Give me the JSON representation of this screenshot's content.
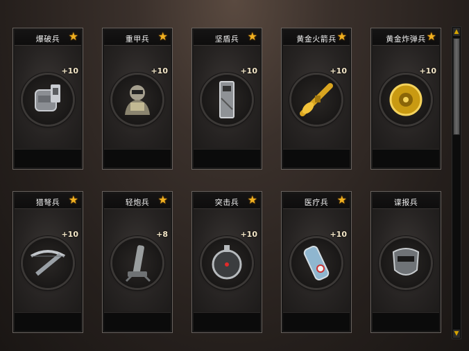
{
  "colors": {
    "star": "#f0b020",
    "accent": "#d6a400"
  },
  "cards": [
    {
      "name": "爆破兵",
      "star": true,
      "plus": "+10",
      "icon": "demolition-vest-icon",
      "gems": [
        "red",
        "red",
        "red",
        "blue",
        "blue",
        "blue",
        "yellow",
        "yellow",
        "yellow",
        "purple"
      ]
    },
    {
      "name": "重甲兵",
      "star": true,
      "plus": "+10",
      "icon": "heavy-armor-soldier-icon",
      "gems": [
        "red",
        "red",
        "red",
        "blue",
        "blue",
        "blue",
        "yellow",
        "yellow",
        "yellow",
        "purple"
      ]
    },
    {
      "name": "坚盾兵",
      "star": true,
      "plus": "+10",
      "icon": "riot-shield-icon",
      "gems": [
        "red",
        "red",
        "red",
        "blue",
        "blue",
        "blue",
        "yellow",
        "yellow",
        "yellow",
        "purple"
      ]
    },
    {
      "name": "黄金火箭兵",
      "star": true,
      "plus": "+10",
      "icon": "gold-rocket-launcher-icon",
      "gems": [
        "red",
        "red",
        "red",
        "blue",
        "blue",
        "blue",
        "yellow",
        "yellow",
        "yellow",
        "purple"
      ]
    },
    {
      "name": "黄金炸弹兵",
      "star": true,
      "plus": "+10",
      "icon": "gold-bomb-icon",
      "gems": [
        "red",
        "red",
        "red",
        "blue",
        "blue",
        "blue",
        "yellow",
        "yellow",
        "yellow",
        "purple"
      ]
    },
    {
      "name": "猎弩兵",
      "star": true,
      "plus": "+10",
      "icon": "crossbow-icon",
      "gems": [
        "red",
        "red",
        "red",
        "blue",
        "blue",
        "blue",
        "yellow",
        "yellow",
        "yellow",
        "purple"
      ]
    },
    {
      "name": "轻炮兵",
      "star": true,
      "plus": "+8",
      "icon": "mortar-icon",
      "gems": [
        "red",
        "red",
        "red",
        "blue",
        "blue",
        "blue",
        "yellow",
        "yellow",
        "purple",
        "empty"
      ]
    },
    {
      "name": "突击兵",
      "star": true,
      "plus": "+10",
      "icon": "assault-scope-icon",
      "gems": [
        "red",
        "red",
        "red",
        "blue",
        "blue",
        "blue",
        "yellow",
        "yellow",
        "yellow",
        "purple"
      ]
    },
    {
      "name": "医疗兵",
      "star": true,
      "plus": "+10",
      "icon": "medic-canister-icon",
      "gems": [
        "red",
        "red",
        "red",
        "blue",
        "blue",
        "blue",
        "yellow",
        "yellow",
        "yellow",
        "empty"
      ]
    },
    {
      "name": "谍报兵",
      "star": false,
      "plus": "",
      "icon": "spy-mask-icon",
      "gems": [
        "empty",
        "empty",
        "empty",
        "empty",
        "empty",
        "empty",
        "empty",
        "empty",
        "empty",
        "empty"
      ]
    }
  ]
}
